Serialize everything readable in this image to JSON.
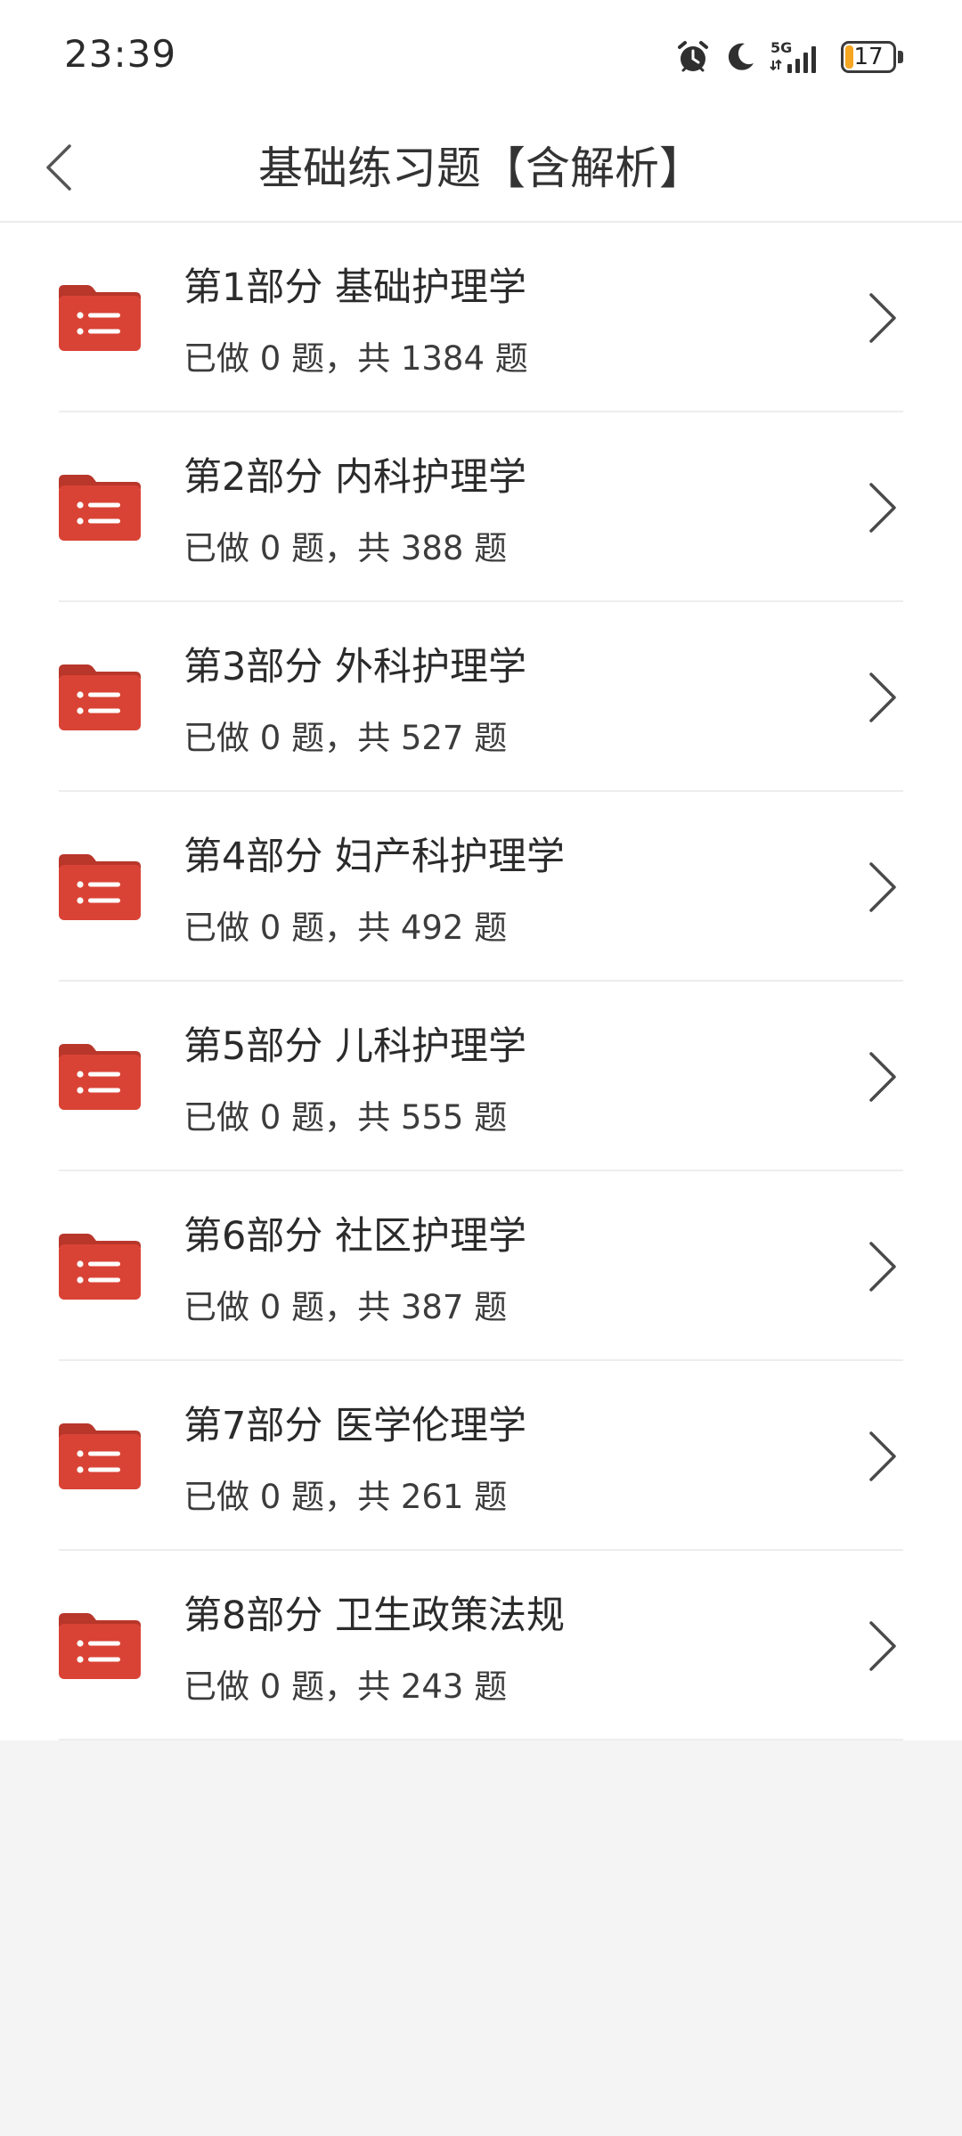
{
  "status_bar": {
    "time": "23:39",
    "network": "5G",
    "battery_level": "17",
    "battery_fraction": 0.17,
    "icons": [
      "alarm-icon",
      "moon-icon",
      "5g-signal-icon",
      "battery-icon"
    ]
  },
  "header": {
    "title": "基础练习题【含解析】",
    "back_icon": "chevron-left-icon"
  },
  "colors": {
    "accent": "#d94335",
    "divider": "#ededed",
    "background": "#f4f4f4"
  },
  "sections": [
    {
      "title": "第1部分 基础护理学",
      "progress": "已做 0 题，共 1384 题"
    },
    {
      "title": "第2部分 内科护理学",
      "progress": "已做 0 题，共 388 题"
    },
    {
      "title": "第3部分 外科护理学",
      "progress": "已做 0 题，共 527 题"
    },
    {
      "title": "第4部分 妇产科护理学",
      "progress": "已做 0 题，共 492 题"
    },
    {
      "title": "第5部分 儿科护理学",
      "progress": "已做 0 题，共 555 题"
    },
    {
      "title": "第6部分 社区护理学",
      "progress": "已做 0 题，共 387 题"
    },
    {
      "title": "第7部分 医学伦理学",
      "progress": "已做 0 题，共 261 题"
    },
    {
      "title": "第8部分 卫生政策法规",
      "progress": "已做 0 题，共 243 题"
    }
  ]
}
